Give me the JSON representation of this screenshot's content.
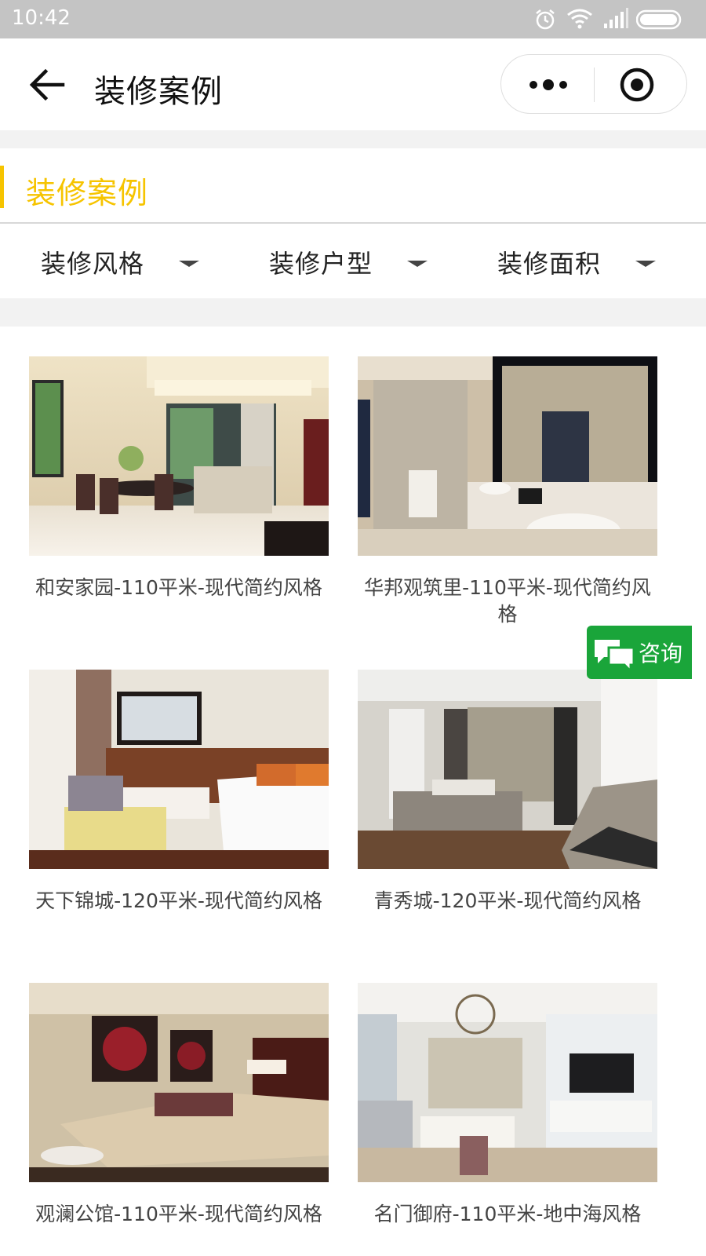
{
  "status_bar": {
    "time": "10:42"
  },
  "nav": {
    "title": "装修案例"
  },
  "section": {
    "title": "装修案例"
  },
  "filters": [
    {
      "label": "装修风格"
    },
    {
      "label": "装修户型"
    },
    {
      "label": "装修面积"
    }
  ],
  "cases": [
    {
      "caption": "和安家园-110平米-现代简约风格"
    },
    {
      "caption": "华邦观筑里-110平米-现代简约风格"
    },
    {
      "caption": "天下锦城-120平米-现代简约风格"
    },
    {
      "caption": "青秀城-120平米-现代简约风格"
    },
    {
      "caption": "观澜公馆-110平米-现代简约风格"
    },
    {
      "caption": "名门御府-110平米-地中海风格"
    }
  ],
  "consult_button": {
    "label": "咨询",
    "color": "#1aa53a"
  },
  "colors": {
    "accent": "#f6c400",
    "status_bar": "#c4c4c4"
  }
}
